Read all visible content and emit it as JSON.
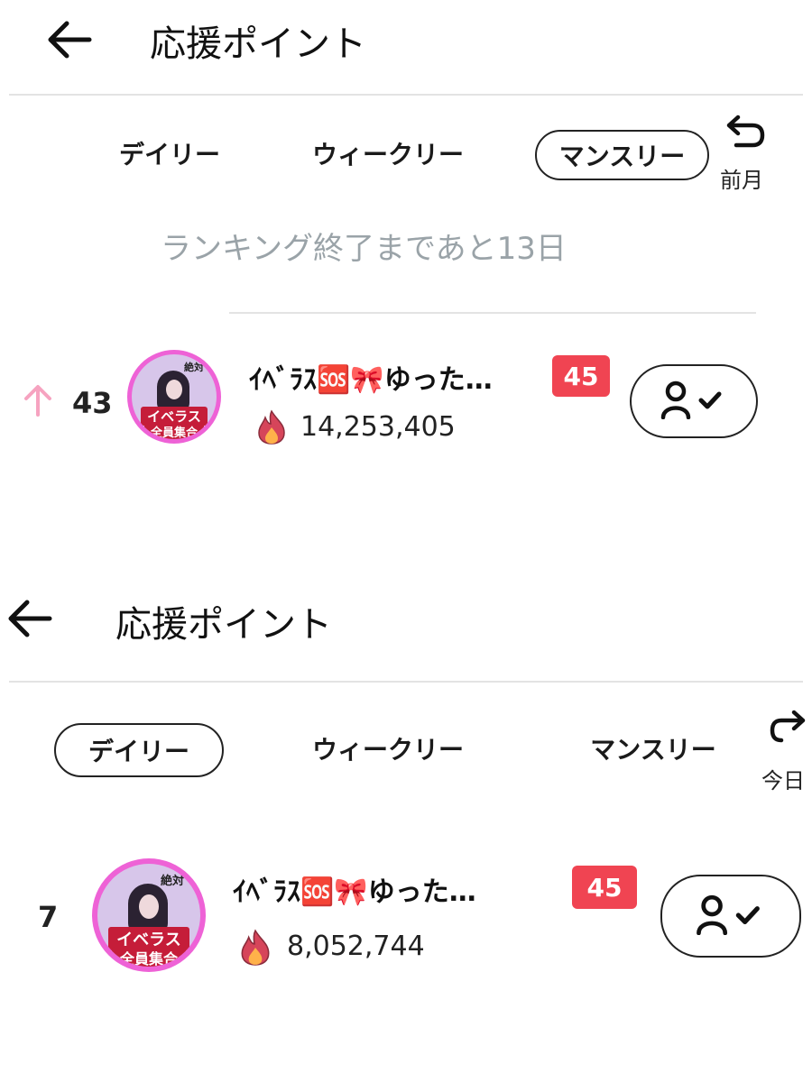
{
  "top": {
    "title": "応援ポイント",
    "tabs": [
      {
        "label": "デイリー",
        "active": false
      },
      {
        "label": "ウィークリー",
        "active": false
      },
      {
        "label": "マンスリー",
        "active": true
      }
    ],
    "side_label": "前月",
    "countdown": "ランキング終了まであと13日",
    "entry": {
      "rank": "43",
      "rank_trend": "up",
      "name": "ｲﾍﾞﾗｽ🆘🎀ゆった…",
      "avatar_text_top": "絶対",
      "avatar_text_1": "イベラス",
      "avatar_text_2": "全員集合",
      "level": "45",
      "points": "14,253,405"
    }
  },
  "bottom": {
    "title": "応援ポイント",
    "tabs": [
      {
        "label": "デイリー",
        "active": true
      },
      {
        "label": "ウィークリー",
        "active": false
      },
      {
        "label": "マンスリー",
        "active": false
      }
    ],
    "side_label": "今日",
    "entry": {
      "rank": "7",
      "name": "ｲﾍﾞﾗｽ🆘🎀ゆった…",
      "avatar_text_top": "絶対",
      "avatar_text_1": "イベラス",
      "avatar_text_2": "全員集合",
      "level": "45",
      "points": "8,052,744"
    }
  },
  "colors": {
    "accent_pink": "#ee62d6",
    "badge_red": "#f04452",
    "trend_up": "#f6a3c0",
    "muted_text": "#9aa3a8"
  },
  "icons": {
    "back": "arrow-left-icon",
    "previous": "undo-arrow-icon",
    "points": "flame-icon",
    "follow": "user-check-icon",
    "trend": "arrow-up-icon"
  }
}
